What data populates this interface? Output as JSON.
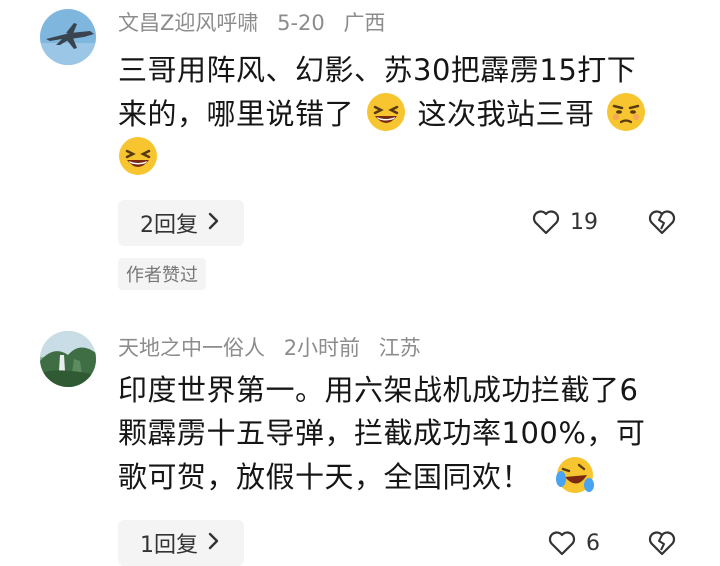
{
  "comments": [
    {
      "username": "文昌Z迎风呼啸",
      "date": "5-20",
      "location": "广西",
      "text_line1": "三哥用阵风、幻影、苏30把霹雳15打下",
      "text_line2a": "来的，哪里说错了",
      "text_line2b": "这次我站三哥",
      "reply_label": "2回复",
      "likes": "19",
      "author_liked": "作者赞过",
      "emojis": [
        "grinning-squint-emoji",
        "unamused-emoji",
        "grinning-squint-emoji"
      ]
    },
    {
      "username": "天地之中一俗人",
      "date": "2小时前",
      "location": "江苏",
      "text_line1": "印度世界第一。用六架战机成功拦截了6",
      "text_line2": "颗霹雳十五导弹，拦截成功率100%，可",
      "text_line3": "歌可贺，放假十天，全国同欢！",
      "reply_label": "1回复",
      "likes": "6",
      "emojis": [
        "laughing-tears-emoji"
      ]
    }
  ],
  "icons": {
    "reply_chevron": "chevron-right-icon",
    "like": "heart-outline-icon",
    "dislike": "broken-heart-icon"
  },
  "colors": {
    "meta_text": "#8c8c8c",
    "reply_bg": "#f4f4f4",
    "emoji_yellow": "#f7c52f"
  }
}
